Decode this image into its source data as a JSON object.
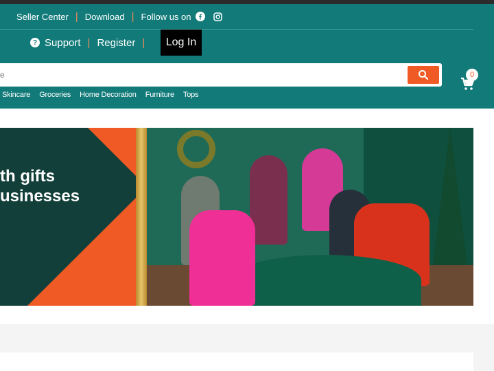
{
  "header": {
    "links": [
      "Seller Center",
      "Download",
      "Follow us on"
    ],
    "support": "Support",
    "register": "Register",
    "login": "Log In",
    "separator": "|"
  },
  "search": {
    "placeholder": "re"
  },
  "cart": {
    "count": "0"
  },
  "categories": [
    "Skincare",
    "Groceries",
    "Home Decoration",
    "Furniture",
    "Tops"
  ],
  "banner": {
    "headline_line1": "th gifts",
    "headline_line2": "usinesses"
  },
  "colors": {
    "header_bg": "#127b79",
    "accent": "#f05a24",
    "login_bg": "#000000"
  },
  "icons": [
    "facebook-icon",
    "instagram-icon",
    "help-icon",
    "search-icon",
    "cart-icon"
  ]
}
